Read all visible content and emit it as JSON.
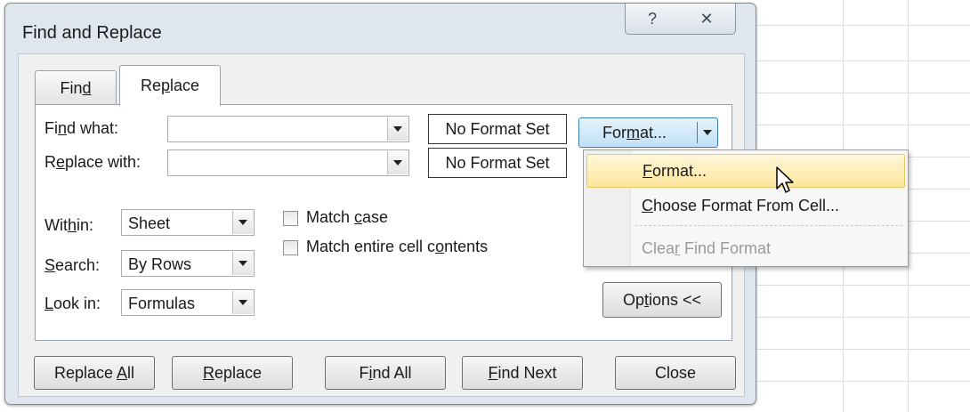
{
  "dialog": {
    "title": "Find and Replace",
    "help_icon": "help-icon",
    "close_icon": "close-icon"
  },
  "tabs": [
    {
      "label": "Find",
      "active": false
    },
    {
      "label": "Replace",
      "active": true
    }
  ],
  "find_what": {
    "label": "Find what:",
    "value": "",
    "format_status": "No Format Set"
  },
  "replace_with": {
    "label": "Replace with:",
    "value": "",
    "format_status": "No Format Set"
  },
  "format_button": {
    "label": "Format..."
  },
  "options": {
    "within": {
      "label": "Within:",
      "value": "Sheet"
    },
    "search": {
      "label": "Search:",
      "value": "By Rows"
    },
    "look_in": {
      "label": "Look in:",
      "value": "Formulas"
    },
    "match_case": {
      "label": "Match case",
      "checked": false
    },
    "match_entire": {
      "label": "Match entire cell contents",
      "checked": false
    },
    "options_button": "Options <<"
  },
  "format_menu": [
    {
      "label": "Format...",
      "highlighted": true,
      "disabled": false
    },
    {
      "label": "Choose Format From Cell...",
      "highlighted": false,
      "disabled": false
    },
    {
      "label": "Clear Find Format",
      "highlighted": false,
      "disabled": true
    }
  ],
  "buttons": {
    "replace_all": "Replace All",
    "replace": "Replace",
    "find_all": "Find All",
    "find_next": "Find Next",
    "close": "Close"
  },
  "colors": {
    "dialog_frame": "#dfe6ee",
    "menu_highlight": "#fde69b",
    "format_button": "#bfe0f7"
  }
}
